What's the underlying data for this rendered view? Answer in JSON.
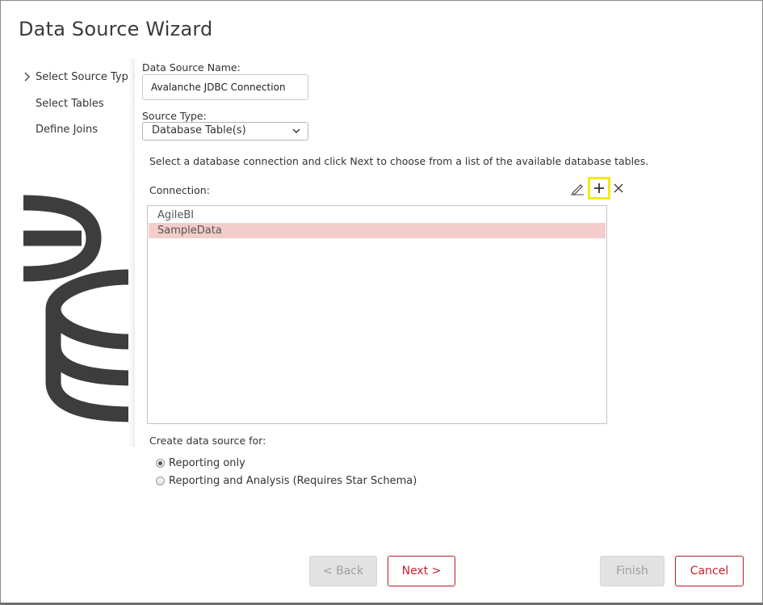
{
  "dialog": {
    "title": "Data Source Wizard"
  },
  "nav": {
    "items": [
      {
        "label": "Select Source Type",
        "active": true
      },
      {
        "label": "Select Tables",
        "active": false
      },
      {
        "label": "Define Joins",
        "active": false
      }
    ]
  },
  "form": {
    "name_label": "Data Source Name:",
    "name_value": "Avalanche JDBC Connection",
    "source_type_label": "Source Type:",
    "source_type_value": "Database Table(s)",
    "instructions": "Select a database connection and click Next to choose from a list of the available database tables.",
    "connection_label": "Connection:",
    "connections": [
      {
        "label": "AgileBI",
        "selected": false
      },
      {
        "label": "SampleData",
        "selected": true
      }
    ],
    "create_for_label": "Create data source for:",
    "options": [
      {
        "label": "Reporting only",
        "checked": true
      },
      {
        "label": "Reporting and Analysis (Requires Star Schema)",
        "checked": false
      }
    ]
  },
  "toolbar": {
    "edit_icon": "pencil-icon",
    "add_icon": "plus-icon",
    "delete_icon": "close-icon",
    "highlight_color": "#f3ea16"
  },
  "buttons": {
    "back": "< Back",
    "next": "Next >",
    "finish": "Finish",
    "cancel": "Cancel"
  },
  "colors": {
    "accent": "#c8202f",
    "selection": "#f3cccc",
    "deco_dark": "#3d3d3d"
  }
}
